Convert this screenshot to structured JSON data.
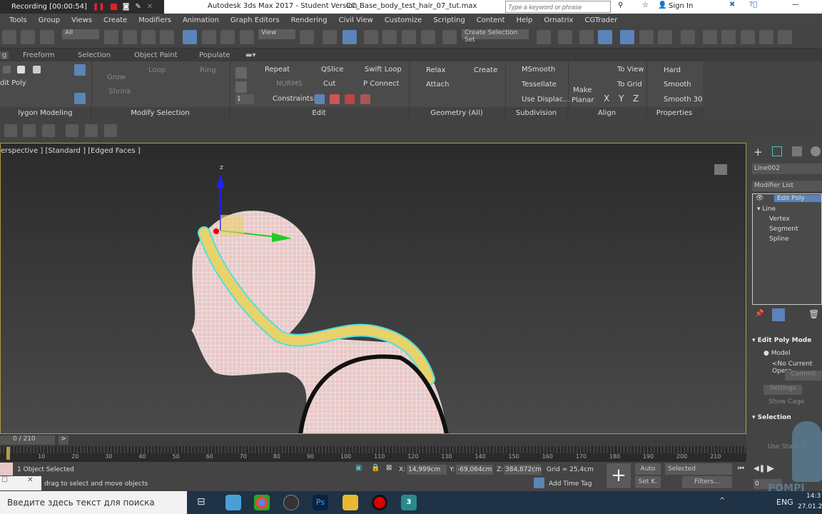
{
  "recorder": {
    "label": "Recording [00:00:54]"
  },
  "window": {
    "title": "Autodesk 3ds Max 2017 - Student Version",
    "file": "CC_Base_body_test_hair_07_tut.max",
    "search_placeholder": "Type a keyword or phrase",
    "sign_in": "Sign In"
  },
  "menu": [
    "Tools",
    "Group",
    "Views",
    "Create",
    "Modifiers",
    "Animation",
    "Graph Editors",
    "Rendering",
    "Civil View",
    "Customize",
    "Scripting",
    "Content",
    "Help",
    "Ornatrix",
    "CGTrader"
  ],
  "toolbar": {
    "filter": "All",
    "ref_coord": "View",
    "selection_set": "Create Selection Set"
  },
  "ribbon_tabs": [
    "g",
    "Freeform",
    "Selection",
    "Object Paint",
    "Populate"
  ],
  "ribbon": {
    "poly": {
      "edit_poly": "dit Poly",
      "label": "lygon Modeling"
    },
    "modsel": {
      "grow": "Grow",
      "shrink": "Shrink",
      "loop": "Loop",
      "ring": "Ring",
      "label": "Modify Selection"
    },
    "edit": {
      "repeat": "Repeat",
      "qslice": "QSlice",
      "swift_loop": "Swift Loop",
      "nurms": "NURMS",
      "cut": "Cut",
      "p_connect": "P Connect",
      "constraints": "Constraints:",
      "spinner": "1",
      "label": "Edit"
    },
    "geometry": {
      "relax": "Relax",
      "create": "Create",
      "attach": "Attach",
      "label": "Geometry (All)"
    },
    "subdivision": {
      "msmooth": "MSmooth",
      "tessellate": "Tessellate",
      "use_displac": "Use Displac...",
      "label": "Subdivision"
    },
    "align": {
      "make": "Make",
      "planar": "Planar",
      "to_view": "To View",
      "to_grid": "To Grid",
      "x": "X",
      "y": "Y",
      "z": "Z",
      "label": "Align"
    },
    "properties": {
      "hard": "Hard",
      "smooth": "Smooth",
      "smooth30": "Smooth 30",
      "label": "Properties"
    }
  },
  "viewport": {
    "label": "erspective ] [Standard ] [Edged Faces ]",
    "axis_z": "z"
  },
  "command_panel": {
    "object_name": "Line002",
    "modifier_list": "Modifier List",
    "stack": [
      "Edit Poly",
      "Line",
      "Vertex",
      "Segment",
      "Spline"
    ],
    "edit_poly_mode": "Edit Poly Mode",
    "model": "Model",
    "no_op": "<No Current Opera",
    "commit": "Commit",
    "settings": "Settings",
    "show_cage": "Show Cage",
    "selection": "Selection",
    "use_stack": "Use Stack S"
  },
  "timeline": {
    "frame": "0 / 210",
    "ticks": [
      "0",
      "10",
      "20",
      "30",
      "40",
      "50",
      "60",
      "70",
      "80",
      "90",
      "100",
      "110",
      "120",
      "130",
      "140",
      "150",
      "160",
      "170",
      "180",
      "190",
      "200",
      "210"
    ]
  },
  "status": {
    "selected": "1 Object Selected",
    "prompt": "drag to select and move objects",
    "x": "14,999cm",
    "y": "-69,064cm",
    "z": "384,872cm",
    "grid": "Grid = 25,4cm",
    "add_time_tag": "Add Time Tag",
    "auto": "Auto",
    "set_k": "Set K.",
    "selected_dd": "Selected",
    "filters": "Filters...",
    "frame_spinner": "0"
  },
  "taskbar": {
    "search": "Введите здесь текст для поиска",
    "lang": "ENG",
    "time": "14:3",
    "date": "27.01.2"
  },
  "watermark": "POMPI",
  "colors": {
    "accent": "#5b84b8",
    "hair": "#e8d26a",
    "selection_outline": "#4fe0e0",
    "skin": "#e8c8c8"
  }
}
